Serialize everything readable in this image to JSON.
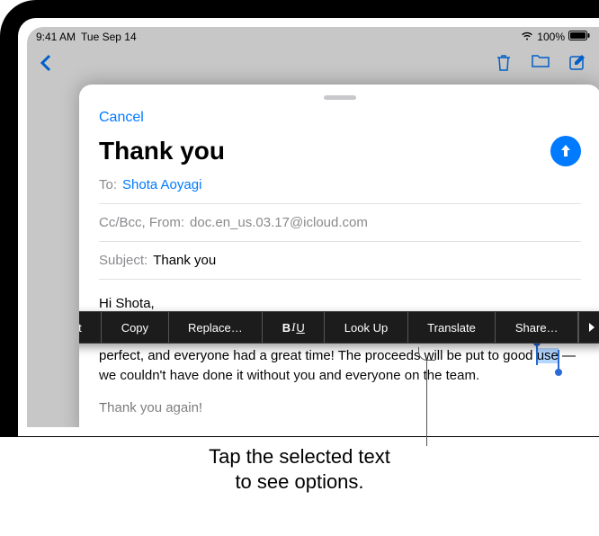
{
  "status": {
    "time": "9:41 AM",
    "date": "Tue Sep 14",
    "battery": "100%"
  },
  "sheet": {
    "cancel": "Cancel",
    "title": "Thank you",
    "to_label": "To:",
    "to_value": "Shota Aoyagi",
    "cc_label": "Cc/Bcc, From:",
    "cc_value": "doc.en_us.03.17@icloud.com",
    "subject_label": "Subject:",
    "subject_value": "Thank you",
    "body_greeting": "Hi Shota,",
    "body_line_pre": "Thanks so much for helping out with the fund-raising dinner. Everything was perfect, and everyone had a great time! The proceeds will be put to good ",
    "body_selected": "use",
    "body_line_post": " — we couldn't have done it without you and everyone on the team.",
    "body_closing": "Thank you again!"
  },
  "editmenu": {
    "items": [
      "Cut",
      "Copy",
      "Replace…",
      "B I U",
      "Look Up",
      "Translate",
      "Share…"
    ]
  },
  "callout": {
    "line1": "Tap the selected text",
    "line2": "to see options."
  }
}
